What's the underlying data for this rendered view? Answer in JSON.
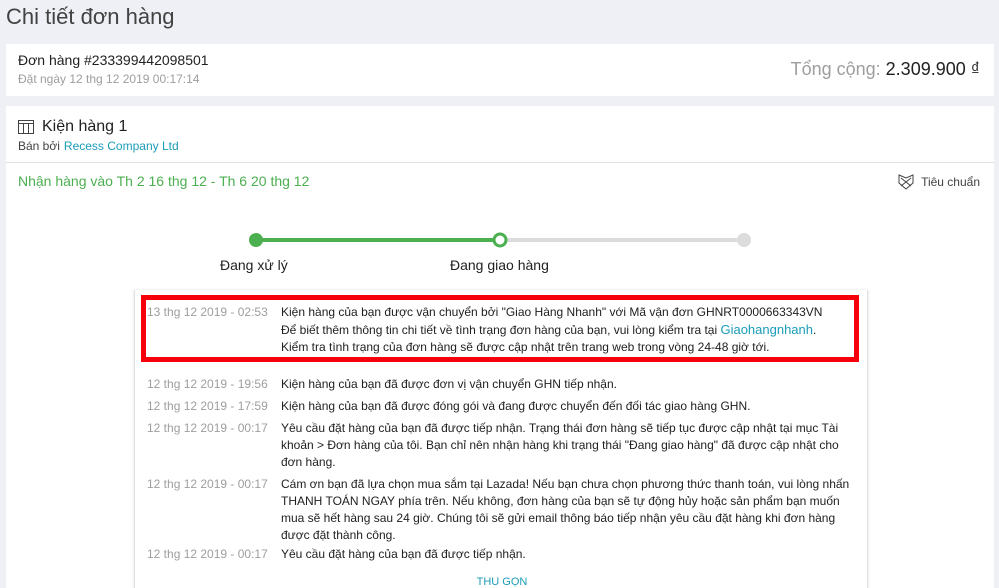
{
  "page": {
    "title": "Chi tiết đơn hàng"
  },
  "order": {
    "number": "Đơn hàng #233399442098501",
    "placed": "Đặt ngày 12 thg 12 2019 00:17:14",
    "total_label": "Tổng cộng: ",
    "total_amount": "2.309.900 ₫"
  },
  "package": {
    "title": "Kiện hàng 1",
    "icon": "package-icon",
    "sold_by_label": "Bán bởi",
    "seller": "Recess Company Ltd",
    "delivery_window": "Nhận hàng vào Th 2 16 thg 12 - Th 6 20 thg 12",
    "shipping_type": "Tiêu chuẩn",
    "shipping_icon": "delivery-icon"
  },
  "progress": {
    "steps": [
      {
        "label": "Đang xử lý",
        "state": "done"
      },
      {
        "label": "Đang giao hàng",
        "state": "current"
      },
      {
        "label": "",
        "state": "pending"
      }
    ],
    "colors": {
      "done": "#4caf50",
      "pending": "#dcdcdc"
    }
  },
  "timeline": {
    "events": [
      {
        "time": "13 thg 12 2019 - 02:53",
        "line1": "Kiện hàng của bạn được vận chuyển bởi \"Giao Hàng Nhanh\" với Mã vận đơn GHNRT0000663343VN",
        "line2_prefix": "Để biết thêm thông tin chi tiết về tình trạng đơn hàng của bạn, vui lòng kiểm tra tại ",
        "line2_link": "Giaohangnhanh",
        "line2_suffix": ".",
        "line3": "Kiểm tra tình trạng của đơn hàng sẽ được cập nhật trên trang web trong vòng 24-48 giờ tới."
      },
      {
        "time": "12 thg 12 2019 - 19:56",
        "message": "Kiện hàng của bạn đã được đơn vị vận chuyển GHN tiếp nhận."
      },
      {
        "time": "12 thg 12 2019 - 17:59",
        "message": "Kiện hàng của bạn đã được đóng gói và đang được chuyển đến đối tác giao hàng GHN."
      },
      {
        "time": "12 thg 12 2019 - 00:17",
        "message": "Yêu cầu đặt hàng của bạn đã được tiếp nhận. Trạng thái đơn hàng sẽ tiếp tục được cập nhật tại mục Tài khoản > Đơn hàng của tôi. Bạn chỉ nên nhận hàng khi trạng thái \"Đang giao hàng\" đã được cập nhật cho đơn hàng."
      },
      {
        "time": "12 thg 12 2019 - 00:17",
        "message": "Cám ơn bạn đã lựa chọn mua sắm tại Lazada! Nếu bạn chưa chọn phương thức thanh toán, vui lòng nhấn THANH TOÁN NGAY phía trên. Nếu không, đơn hàng của bạn sẽ tự động hủy hoặc sản phẩm bạn muốn mua sẽ hết hàng sau 24 giờ. Chúng tôi sẽ gửi email thông báo tiếp nhận yêu cầu đặt hàng khi đơn hàng được đặt thành công."
      },
      {
        "time": "12 thg 12 2019 - 00:17",
        "message": "Yêu cầu đặt hàng của bạn đã được tiếp nhận."
      }
    ],
    "collapse_label": "THU GỌN",
    "highlight_color": "#f5000b"
  }
}
